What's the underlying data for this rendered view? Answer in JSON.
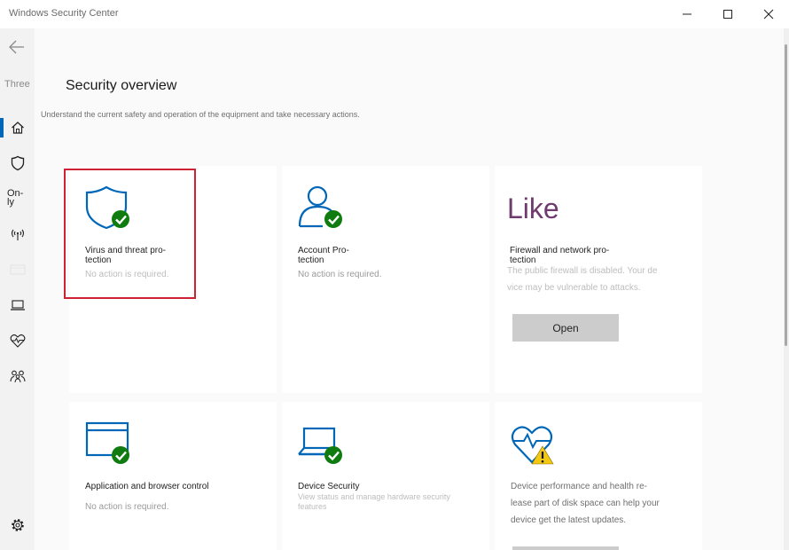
{
  "window": {
    "title": "Windows Security Center"
  },
  "sidebar": {
    "collapsed_label": "Three",
    "only_label_line1": "On-",
    "only_label_line2": "ly"
  },
  "overview": {
    "title": "Security overview",
    "description": "Understand the current safety and operation of the equipment and take necessary actions."
  },
  "cards": [
    {
      "title_line1": "Virus and threat pro-",
      "title_line2": "tection",
      "status": "No action is required."
    },
    {
      "title_line1": "Account Pro-",
      "title_line2": "tection",
      "status": "No action is required."
    },
    {
      "image_text": "Like",
      "title_line1": "Firewall and network pro-",
      "title_line2": "tection",
      "desc_line1": "The public firewall is disabled. Your de",
      "desc_line2": "vice may be vulnerable to attacks.",
      "button_label": "Open"
    },
    {
      "title": "Application and browser control",
      "status": "No action is required."
    },
    {
      "title": "Device Security",
      "desc_line1": "View status and manage hardware security",
      "desc_line2": "features"
    },
    {
      "desc_line1": "Device performance and health re-",
      "desc_line2": "lease part of disk space can help your",
      "desc_line3": "device get the latest updates."
    }
  ],
  "colors": {
    "accent_blue": "#0067b8",
    "ok_green": "#107c10",
    "warning_yellow": "#f2c811",
    "highlight_red": "#cc2233",
    "like_purple": "#6f3a6d"
  }
}
